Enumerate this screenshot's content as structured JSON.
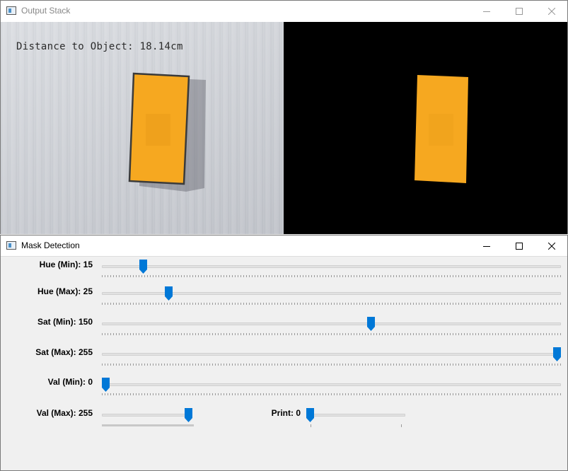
{
  "output_window": {
    "title": "Output Stack",
    "overlay_text": "Distance to Object: 18.14cm"
  },
  "mask_window": {
    "title": "Mask Detection",
    "trackbars": [
      {
        "label": "Hue (Min): 15",
        "value": 15,
        "max": 179
      },
      {
        "label": "Hue (Max): 25",
        "value": 25,
        "max": 179
      },
      {
        "label": "Sat (Min): 150",
        "value": 150,
        "max": 255
      },
      {
        "label": "Sat (Max): 255",
        "value": 255,
        "max": 255
      },
      {
        "label": "Val (Min): 0",
        "value": 0,
        "max": 255
      },
      {
        "label": "Val (Max): 255",
        "value": 255,
        "max": 255
      },
      {
        "label": "Print: 0",
        "value": 0,
        "max": 1
      }
    ]
  },
  "colors": {
    "thumb": "#0078d7",
    "object": "#f6a820"
  },
  "icons": [
    "app-icon",
    "minimize-icon",
    "maximize-icon",
    "close-icon"
  ]
}
